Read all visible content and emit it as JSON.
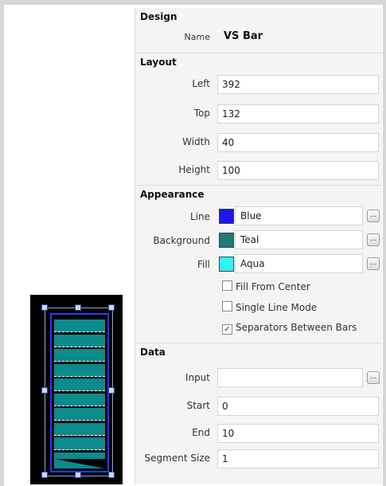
{
  "design": {
    "header": "Design",
    "name_label": "Name",
    "name_value": "VS Bar"
  },
  "layout": {
    "header": "Layout",
    "left_label": "Left",
    "left_value": "392",
    "top_label": "Top",
    "top_value": "132",
    "width_label": "Width",
    "width_value": "40",
    "height_label": "Height",
    "height_value": "100"
  },
  "appearance": {
    "header": "Appearance",
    "line_label": "Line",
    "line_value": "Blue",
    "line_color": "#1c14ff",
    "background_label": "Background",
    "background_value": "Teal",
    "background_color": "#1e7b7a",
    "fill_label": "Fill",
    "fill_value": "Aqua",
    "fill_color": "#2ff2f2",
    "ellipsis": "...",
    "fill_from_center_label": "Fill From Center",
    "fill_from_center_checked": false,
    "single_line_mode_label": "Single Line Mode",
    "single_line_mode_checked": false,
    "separators_label": "Separators Between Bars",
    "separators_checked": true,
    "check_mark": "✓"
  },
  "data": {
    "header": "Data",
    "input_label": "Input",
    "input_value": "",
    "start_label": "Start",
    "start_value": "0",
    "end_label": "End",
    "end_value": "10",
    "segment_size_label": "Segment Size",
    "segment_size_value": "1"
  },
  "preview": {
    "bar_line_color": "#2a36ff",
    "bar_fill_color": "#0c8a8c",
    "full_segments": 10,
    "fill_level": 0.95
  }
}
